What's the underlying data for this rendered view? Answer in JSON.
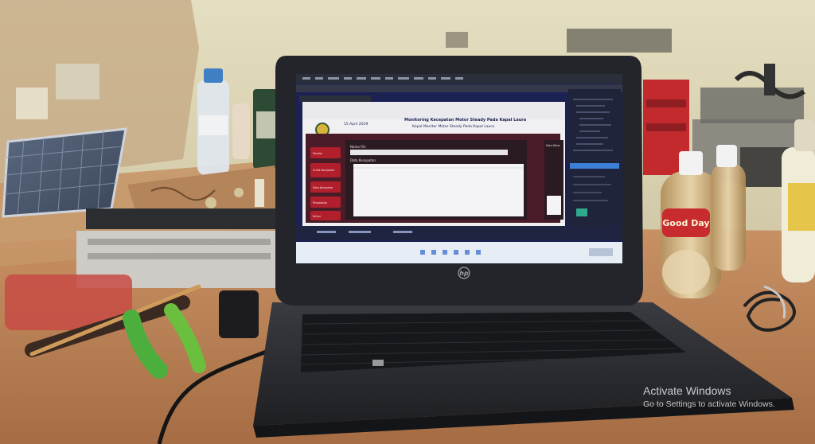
{
  "photo": {
    "subject": "laptop-on-workbench",
    "laptop_brand": "hp",
    "screen_app": {
      "time_label": "15 April 2019",
      "heading_line1": "Monitoring Kecepatan Motor Steady Pada Kapal Laura",
      "heading_line2": "Kapal Monitor Motor Steady Pada Kapal Laura",
      "nav_items": [
        "Monitor",
        "Grafik Kecepatan",
        "Data Kecepatan",
        "Pengaturan",
        "Keluar"
      ],
      "panel_title_1": "Nama File",
      "panel_title_2": "Data Kecepatan",
      "side_title": "Data Motor"
    },
    "bottle_label": "Good Day"
  },
  "watermark": {
    "line1": "Activate Windows",
    "line2": "Go to Settings to activate Windows."
  },
  "colors": {
    "wall": "#ddd7b6",
    "desk": "#b97f52",
    "laptop_body": "#27282c",
    "screen_bg": "#1b2152",
    "accent_red": "#b11f2c"
  }
}
